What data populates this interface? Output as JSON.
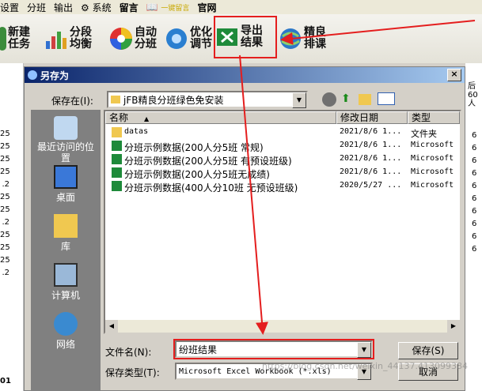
{
  "menu": {
    "items": [
      "设置",
      "分班",
      "输出",
      "系统",
      "留言",
      "一键留言",
      "官网"
    ]
  },
  "toolbar": {
    "buttons": [
      {
        "label": "新建任务"
      },
      {
        "label": "分段均衡"
      },
      {
        "label": "自动分班"
      },
      {
        "label": "优化调节"
      },
      {
        "label": "导出结果"
      },
      {
        "label": "精良排课"
      }
    ]
  },
  "grid": {
    "left_values": [
      "25",
      "25",
      "25",
      "25",
      ".2",
      "25",
      "25",
      ".2",
      "25",
      "25",
      "25",
      ".2",
      "01"
    ],
    "right_header": "后60人",
    "right_values": [
      "6",
      "6",
      "6",
      "6",
      "6",
      "6",
      "6",
      "6",
      "6",
      "6"
    ]
  },
  "dialog": {
    "title": "另存为",
    "close": "×",
    "save_in_label": "保存在(I):",
    "save_in_value": "jFB精良分班绿色免安装",
    "places": [
      "最近访问的位置",
      "桌面",
      "库",
      "计算机",
      "网络"
    ],
    "columns": [
      "名称",
      "修改日期",
      "类型"
    ],
    "files": [
      {
        "name": "datas",
        "date": "2021/8/6 1...",
        "type": "文件夹",
        "folder": true
      },
      {
        "name": "分班示例数据(200人分5班 常规)",
        "date": "2021/8/6 1...",
        "type": "Microsoft",
        "folder": false
      },
      {
        "name": "分班示例数据(200人分5班 有预设班级)",
        "date": "2021/8/6 1...",
        "type": "Microsoft",
        "folder": false
      },
      {
        "name": "分班示例数据(200人分5班无成绩)",
        "date": "2021/8/6 1...",
        "type": "Microsoft",
        "folder": false
      },
      {
        "name": "分班示例数据(400人分10班 无预设班级)",
        "date": "2020/5/27 ...",
        "type": "Microsoft",
        "folder": false
      }
    ],
    "filename_label": "文件名(N):",
    "filename_value": "纷班结果",
    "filetype_label": "保存类型(T):",
    "filetype_value": "Microsoft Excel Workbook (*.xls)",
    "save_button": "保存(S)",
    "cancel_button": "取消",
    "watermark": "https://blog.csdn.net/weixin_44137.413099384"
  },
  "colors": {
    "annotation_red": "#e41e1e",
    "title_blue": "#0a246a"
  }
}
